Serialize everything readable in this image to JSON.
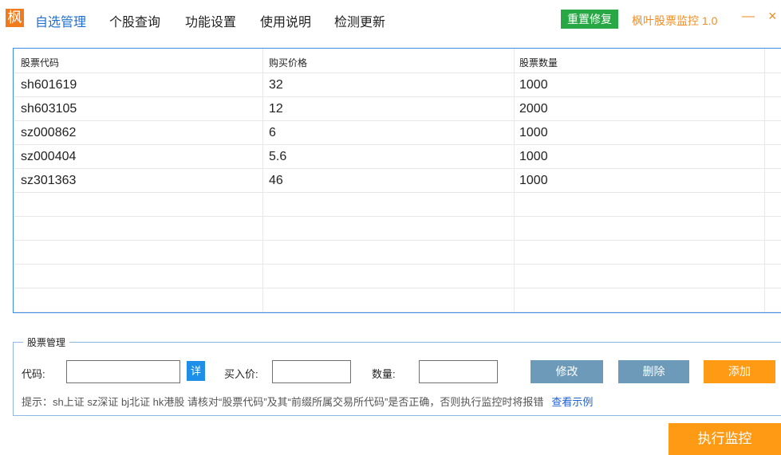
{
  "header": {
    "logo_char": "枫",
    "menu": [
      "自选管理",
      "个股查询",
      "功能设置",
      "使用说明",
      "检测更新"
    ],
    "reset_label": "重置修复",
    "app_title": "枫叶股票监控 1.0",
    "minimize_glyph": "—",
    "close_glyph": "×"
  },
  "table": {
    "columns": [
      "股票代码",
      "购买价格",
      "股票数量"
    ],
    "rows": [
      [
        "sh601619",
        "32",
        "1000"
      ],
      [
        "sh603105",
        "12",
        "2000"
      ],
      [
        "sz000862",
        "6",
        "1000"
      ],
      [
        "sz000404",
        "5.6",
        "1000"
      ],
      [
        "sz301363",
        "46",
        "1000"
      ]
    ]
  },
  "manage": {
    "title": "股票管理",
    "code_label": "代码:",
    "detail_label": "详",
    "price_label": "买入价:",
    "qty_label": "数量:",
    "code_value": "",
    "price_value": "",
    "qty_value": "",
    "modify_label": "修改",
    "delete_label": "删除",
    "add_label": "添加",
    "hint": "提示：sh上证 sz深证 bj北证 hk港股  请核对“股票代码”及其“前缀所属交易所代码”是否正确，否则执行监控时将报错",
    "hint_link": "查看示例"
  },
  "exec_label": "执行监控",
  "colors": {
    "accent": "#1e6fd0",
    "orange": "#ff9a14",
    "green": "#27a844",
    "gray_button": "#6d9ab8"
  }
}
